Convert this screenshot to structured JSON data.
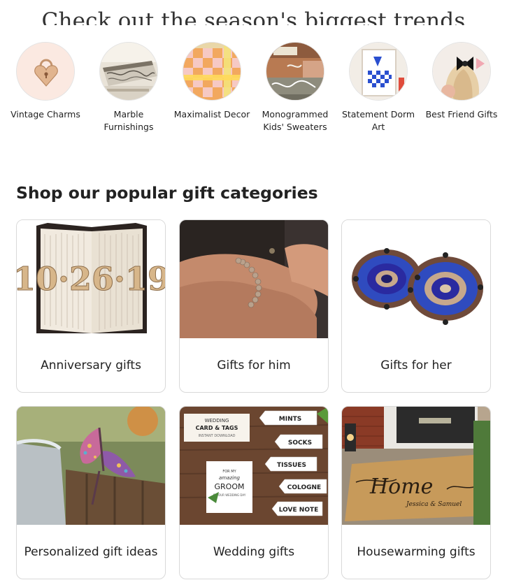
{
  "trends": {
    "title": "Check out the season's biggest trends",
    "items": [
      {
        "label": "Vintage Charms",
        "icon": "heart-lock-charm-image"
      },
      {
        "label": "Marble Furnishings",
        "icon": "marble-tray-image"
      },
      {
        "label": "Maximalist Decor",
        "icon": "checkered-tray-image"
      },
      {
        "label": "Monogrammed Kids' Sweaters",
        "icon": "monogram-sweater-image"
      },
      {
        "label": "Statement Dorm Art",
        "icon": "blue-check-art-image"
      },
      {
        "label": "Best Friend Gifts",
        "icon": "hair-bow-image"
      }
    ]
  },
  "gifts": {
    "title": "Shop our popular gift categories",
    "categories": [
      {
        "label": "Anniversary gifts",
        "icon": "folded-book-art-image",
        "image_text": "10·26·19"
      },
      {
        "label": "Gifts for him",
        "icon": "bracelet-wrist-image"
      },
      {
        "label": "Gifts for her",
        "icon": "beaded-earrings-image"
      },
      {
        "label": "Personalized gift ideas",
        "icon": "paper-butterfly-image"
      },
      {
        "label": "Wedding gifts",
        "icon": "wedding-tags-image",
        "image_text": {
          "header": "WEDDING",
          "header2": "CARD & TAGS",
          "sub": "INSTANT DOWNLOAD",
          "card1": "FOR MY",
          "card2": "amazing",
          "card3": "GROOM",
          "card4": "ON OUR WEDDING DAY",
          "tags": [
            "MINTS",
            "SOCKS",
            "TISSUES",
            "COLOGNE",
            "LOVE NOTE"
          ]
        }
      },
      {
        "label": "Housewarming gifts",
        "icon": "doormat-image",
        "image_text": {
          "word": "Home",
          "names": "Jessica & Samuel"
        }
      }
    ]
  }
}
